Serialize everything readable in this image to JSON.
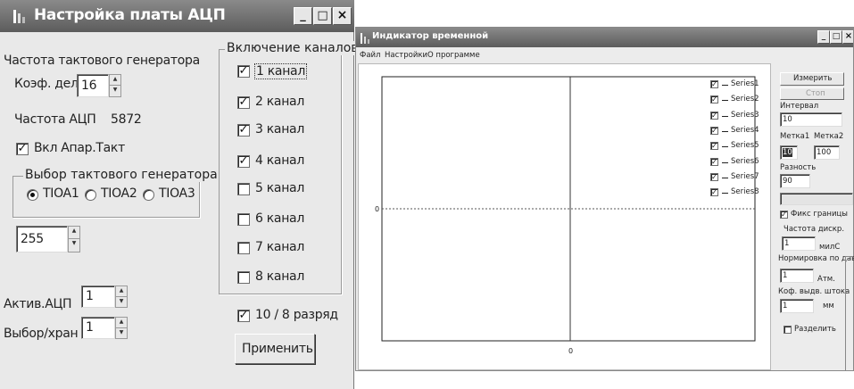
{
  "adc_window": {
    "title": "Настройка платы АЦП",
    "clock_freq_label": "Частота тактового генератора",
    "divider_label": "Коэф. дел.",
    "divider_value": "16",
    "adc_freq_label": "Частота АЦП",
    "adc_freq_value": "5872",
    "hw_clock_label": "Вкл Апар.Такт",
    "hw_clock_checked": true,
    "clock_select_group": "Выбор тактового генератора",
    "clock_options": [
      "TIOA1",
      "TIOA2",
      "TIOA3"
    ],
    "clock_selected": 0,
    "value_255": "255",
    "active_adc_label": "Актив.АЦП",
    "active_adc_value": "1",
    "select_store_label": "Выбор/хран",
    "select_store_value": "1",
    "channels_group": "Включение каналов",
    "channels": [
      {
        "label": "1 канал",
        "checked": true
      },
      {
        "label": "2 канал",
        "checked": true
      },
      {
        "label": "3 канал",
        "checked": true
      },
      {
        "label": "4 канал",
        "checked": true
      },
      {
        "label": "5 канал",
        "checked": false
      },
      {
        "label": "6 канал",
        "checked": false
      },
      {
        "label": "7 канал",
        "checked": false
      },
      {
        "label": "8 канал",
        "checked": false
      }
    ],
    "bits_label": "10 / 8 разряд",
    "bits_checked": true,
    "apply_label": "Применить",
    "title_buttons": [
      "_",
      "□",
      "×"
    ]
  },
  "indicator_window": {
    "title": "Индикатор временной",
    "menu": [
      "Файл",
      "Настройки",
      "О программе"
    ],
    "title_buttons": [
      "_",
      "□",
      "×"
    ],
    "measure_label": "Измерить",
    "stop_label": "Стоп",
    "interval_label": "Интервал",
    "interval_value": "10",
    "mark1_label": "Метка1",
    "mark1_value": "10",
    "mark2_label": "Метка2",
    "mark2_value": "100",
    "diff_label": "Разность",
    "diff_value": "90",
    "fixed_bounds_label": "Фикс границы",
    "fixed_bounds_checked": true,
    "sample_rate_label": "Частота дискр.",
    "sample_rate_value": "1",
    "sample_rate_unit": "милС",
    "pressure_norm_label": "Нормировка по давл",
    "pressure_norm_value": "1",
    "pressure_norm_unit": "Атм.",
    "rod_coef_label": "Коф. выдв. штока",
    "rod_coef_value": "1",
    "rod_coef_unit": "мм",
    "split_label": "Разделить",
    "split_checked": false,
    "chart": {
      "y_zero_label": "0",
      "x_zero_label": "0",
      "legend": [
        {
          "name": "Series1",
          "checked": true
        },
        {
          "name": "Series2",
          "checked": true
        },
        {
          "name": "Series3",
          "checked": true
        },
        {
          "name": "Series4",
          "checked": true
        },
        {
          "name": "Series5",
          "checked": true
        },
        {
          "name": "Series6",
          "checked": true
        },
        {
          "name": "Series7",
          "checked": true
        },
        {
          "name": "Series8",
          "checked": true
        }
      ]
    }
  },
  "colors": {
    "titlebar": "#6e6e6e",
    "window_bg": "#e9e9e9",
    "plot_bg": "#ffffff"
  }
}
